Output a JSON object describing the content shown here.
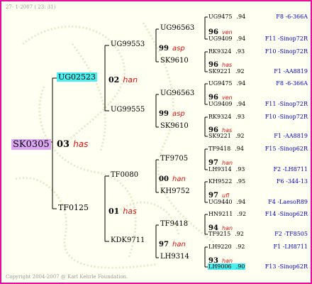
{
  "header": "27- 1-2007 ( 23: 31)",
  "footer": "Copyright 2004-2007 @ Karl Kehrle Foundation.",
  "colors": {
    "border": "#e8109a",
    "highlight": "#4cf0f0",
    "root": "#dca6f2",
    "annotation": "#e01010",
    "location": "#0000cc"
  },
  "root": {
    "id": "SK0305",
    "year": "03",
    "ann": "has"
  },
  "g1": [
    {
      "id": "UG02523",
      "year": "02",
      "ann": "han"
    },
    {
      "id": "TF0125",
      "year": "01",
      "ann": "has"
    }
  ],
  "g2": [
    {
      "id": "UG99553",
      "year": "99",
      "ann": "asp"
    },
    {
      "id": "UG99555",
      "year": "99",
      "ann": "asp"
    },
    {
      "id": "TF0080",
      "year": "00",
      "ann": "han"
    },
    {
      "id": "KDK9711",
      "year": "97",
      "ann": "han"
    }
  ],
  "g3": [
    {
      "id": "UG96563",
      "year": "96",
      "ann": "ven"
    },
    {
      "id": "SK9610",
      "year": "96",
      "ann": "has"
    },
    {
      "id": "UG96563",
      "year": "96",
      "ann": "ven"
    },
    {
      "id": "SK9610",
      "year": "96",
      "ann": "has"
    },
    {
      "id": "TF9705",
      "year": "97",
      "ann": "han"
    },
    {
      "id": "KH9752",
      "year": "97",
      "ann": "ufl"
    },
    {
      "id": "TF9418",
      "year": "94",
      "ann": "han"
    },
    {
      "id": "LH9314",
      "year": "93",
      "ann": "han"
    }
  ],
  "g4": [
    {
      "id": "UG9475",
      "yr": ".94",
      "loc": "F8 -6-366A"
    },
    {
      "id": "UG9409",
      "yr": ".94",
      "loc": "F11 -Sinop72R"
    },
    {
      "id": "RK9324",
      "yr": ".93",
      "loc": "F10 -Sinop72R"
    },
    {
      "id": "SK9221",
      "yr": ".92",
      "loc": "F1 -AA8819"
    },
    {
      "id": "UG9475",
      "yr": ".94",
      "loc": "F8 -6-366A"
    },
    {
      "id": "UG9409",
      "yr": ".94",
      "loc": "F11 -Sinop72R"
    },
    {
      "id": "RK9324",
      "yr": ".93",
      "loc": "F10 -Sinop72R"
    },
    {
      "id": "SK9221",
      "yr": ".92",
      "loc": "F1 -AA8819"
    },
    {
      "id": "TF9418",
      "yr": ".94",
      "loc": "F15 -Sinop62R"
    },
    {
      "id": "LH9314",
      "yr": ".93",
      "loc": "F2 -LH8711"
    },
    {
      "id": "KH9522",
      "yr": ".95",
      "loc": "F6 -344-13"
    },
    {
      "id": "UG9440",
      "yr": ".94",
      "loc": "F4 -LaesoR89"
    },
    {
      "id": "HN9211",
      "yr": ".92",
      "loc": "F14 -Sinop62R"
    },
    {
      "id": "TF9215",
      "yr": ".92",
      "loc": "F2 -TF8505"
    },
    {
      "id": "LH9220",
      "yr": ".92",
      "loc": "F1 -LH8711"
    },
    {
      "id": "LH9006",
      "yr": ".90",
      "loc": "F13 -Sinop62R"
    }
  ]
}
